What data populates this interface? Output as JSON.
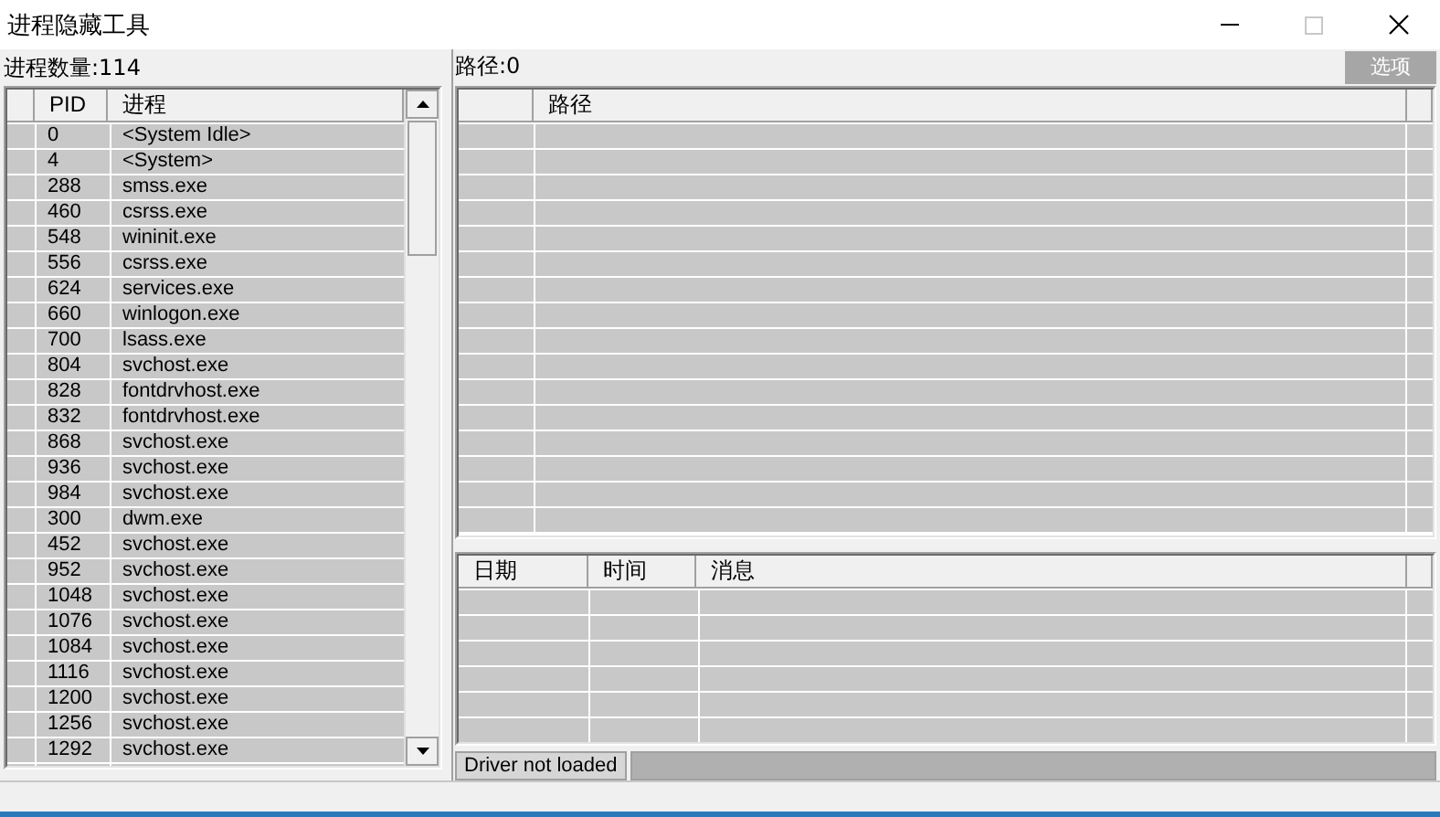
{
  "window": {
    "title": "进程隐藏工具"
  },
  "process_panel": {
    "count_label": "进程数量:114",
    "columns": [
      "PID",
      "进程"
    ],
    "rows": [
      {
        "pid": "0",
        "name": "<System Idle>"
      },
      {
        "pid": "4",
        "name": "<System>"
      },
      {
        "pid": "288",
        "name": "smss.exe"
      },
      {
        "pid": "460",
        "name": "csrss.exe"
      },
      {
        "pid": "548",
        "name": "wininit.exe"
      },
      {
        "pid": "556",
        "name": "csrss.exe"
      },
      {
        "pid": "624",
        "name": "services.exe"
      },
      {
        "pid": "660",
        "name": "winlogon.exe"
      },
      {
        "pid": "700",
        "name": "lsass.exe"
      },
      {
        "pid": "804",
        "name": "svchost.exe"
      },
      {
        "pid": "828",
        "name": "fontdrvhost.exe"
      },
      {
        "pid": "832",
        "name": "fontdrvhost.exe"
      },
      {
        "pid": "868",
        "name": "svchost.exe"
      },
      {
        "pid": "936",
        "name": "svchost.exe"
      },
      {
        "pid": "984",
        "name": "svchost.exe"
      },
      {
        "pid": "300",
        "name": "dwm.exe"
      },
      {
        "pid": "452",
        "name": "svchost.exe"
      },
      {
        "pid": "952",
        "name": "svchost.exe"
      },
      {
        "pid": "1048",
        "name": "svchost.exe"
      },
      {
        "pid": "1076",
        "name": "svchost.exe"
      },
      {
        "pid": "1084",
        "name": "svchost.exe"
      },
      {
        "pid": "1116",
        "name": "svchost.exe"
      },
      {
        "pid": "1200",
        "name": "svchost.exe"
      },
      {
        "pid": "1256",
        "name": "svchost.exe"
      },
      {
        "pid": "1292",
        "name": "svchost.exe"
      }
    ]
  },
  "path_panel": {
    "count_label": "路径:0",
    "options_button": {
      "label": "选项",
      "disabled": true
    },
    "columns": [
      "路径"
    ]
  },
  "log_panel": {
    "columns": [
      "日期",
      "时间",
      "消息"
    ]
  },
  "status_bar": {
    "text": "Driver not loaded"
  }
}
